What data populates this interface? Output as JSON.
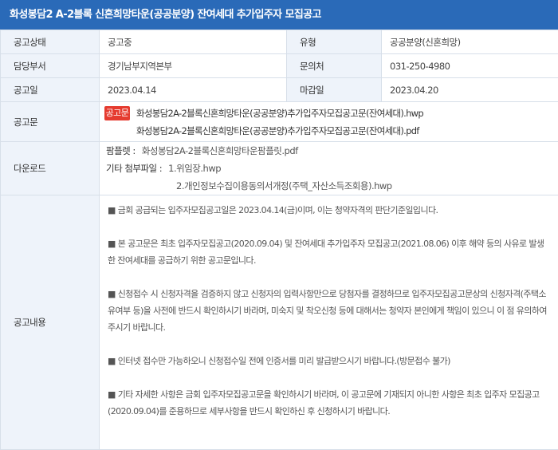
{
  "title": "화성봉담2 A-2블록 신혼희망타운(공공분양) 잔여세대 추가입주자 모집공고",
  "rows": {
    "status": {
      "label": "공고상태",
      "value": "공고중"
    },
    "type": {
      "label": "유형",
      "value": "공공분양(신혼희망)"
    },
    "dept": {
      "label": "담당부서",
      "value": "경기남부지역본부"
    },
    "contact": {
      "label": "문의처",
      "value": "031-250-4980"
    },
    "post_date": {
      "label": "공고일",
      "value": "2023.04.14"
    },
    "deadline": {
      "label": "마감일",
      "value": "2023.04.20"
    }
  },
  "notice": {
    "label": "공고문",
    "badge": "공고문",
    "files": [
      "화성봉담2A-2블록신혼희망타운(공공분양)추가입주자모집공고문(잔여세대).hwp",
      "화성봉담2A-2블록신혼희망타운(공공분양)추가입주자모집공고문(잔여세대).pdf"
    ]
  },
  "download": {
    "label": "다운로드",
    "pamphlet_label": "팜플렛 :",
    "pamphlet_file": "화성봉담2A-2블록신혼희망타운팜플릿.pdf",
    "attach_label": "기타 첨부파일 :",
    "attachments": [
      "1.위임장.hwp",
      "2.개인정보수집이용동의서개정(주택_자산소득조회용).hwp"
    ]
  },
  "content": {
    "label": "공고내용",
    "paragraphs": [
      "■ 금회 공급되는 입주자모집공고일은 2023.04.14(금)이며, 이는 청약자격의 판단기준일입니다.",
      "■ 본 공고문은 최초 입주자모집공고(2020.09.04) 및 잔여세대 추가입주자 모집공고(2021.08.06) 이후 해약 등의 사유로 발생한 잔여세대를 공급하기 위한 공고문입니다.",
      "■ 신청접수 시 신청자격을 검증하지 않고 신청자의 입력사항만으로 당첨자를 결정하므로 입주자모집공고문상의 신청자격(주택소유여부 등)을 사전에 반드시 확인하시기 바라며, 미숙지 및 착오신청 등에 대해서는 청약자 본인에게 책임이 있으니 이 점 유의하여 주시기 바랍니다.",
      "■ 인터넷 접수만 가능하오니 신청접수일 전에 인증서를 미리 발급받으시기 바랍니다.(방문접수 불가)",
      "■ 기타 자세한 사항은 금회 입주자모집공고문을 확인하시기 바라며, 이 공고문에 기재되지 아니한 사항은 최초 입주자 모집공고(2020.09.04)를 준용하므로 세부사항을 반드시 확인하신 후 신청하시기 바랍니다."
    ]
  },
  "colors": {
    "header_bg": "#2a6ab8",
    "label_bg": "#eef3fa",
    "status_red": "#e0281e",
    "badge_red": "#e53b2f"
  }
}
